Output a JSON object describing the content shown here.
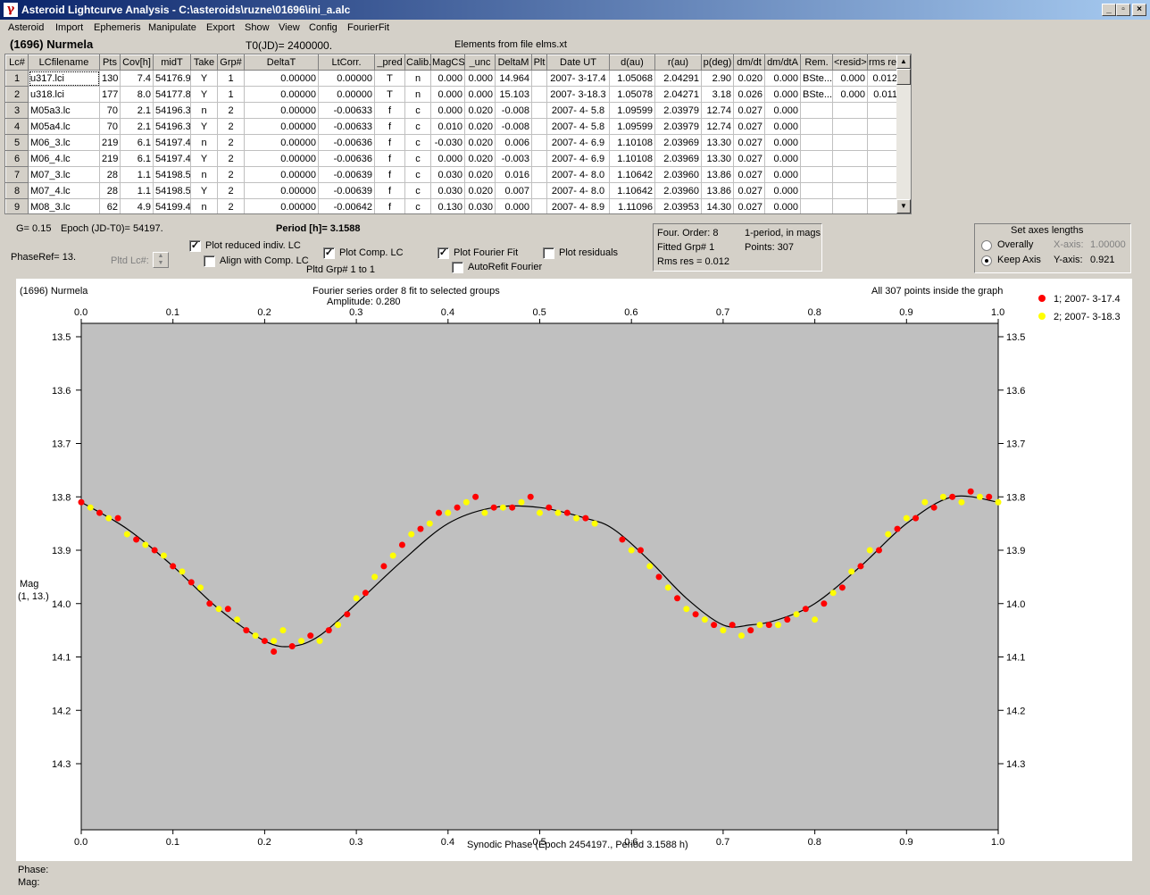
{
  "window": {
    "title": "Asteroid Lightcurve Analysis - C:\\asteroids\\ruzne\\01696\\ini_a.alc",
    "icon": "app-icon",
    "controls": [
      "_",
      "▫",
      "×"
    ]
  },
  "menu": [
    "Asteroid",
    "Import",
    "Ephemeris",
    "Manipulate",
    "Export",
    "Show",
    "View",
    "Config",
    "FourierFit"
  ],
  "info": {
    "asteroid": "(1696) Nurmela",
    "t0": "T0(JD)= 2400000.",
    "elements": "Elements from file elms.xt"
  },
  "table": {
    "headers": [
      "Lc#",
      "LCfilename",
      "Pts",
      "Cov[h]",
      "midT",
      "Take",
      "Grp#",
      "DeltaT",
      "LtCorr.",
      "_pred",
      "Calib.",
      "MagCS",
      "_unc",
      "DeltaM",
      "Plt",
      "Date UT",
      "d(au)",
      "r(au)",
      "p(deg)",
      "dm/dt",
      "dm/dtA",
      "Rem.",
      "<resid>",
      "rms res"
    ],
    "rows": [
      [
        "1",
        "u317.lci",
        "130",
        "7.4",
        "54176.9",
        "Y",
        "1",
        "0.00000",
        "0.00000",
        "T",
        "n",
        "0.000",
        "0.000",
        "14.964",
        "",
        "2007- 3-17.4",
        "1.05068",
        "2.04291",
        "2.90",
        "0.020",
        "0.000",
        "BSte...",
        "0.000",
        "0.012"
      ],
      [
        "2",
        "u318.lci",
        "177",
        "8.0",
        "54177.8",
        "Y",
        "1",
        "0.00000",
        "0.00000",
        "T",
        "n",
        "0.000",
        "0.000",
        "15.103",
        "",
        "2007- 3-18.3",
        "1.05078",
        "2.04271",
        "3.18",
        "0.026",
        "0.000",
        "BSte...",
        "0.000",
        "0.011"
      ],
      [
        "3",
        "M05a3.lc",
        "70",
        "2.1",
        "54196.3",
        "n",
        "2",
        "0.00000",
        "-0.00633",
        "f",
        "c",
        "0.000",
        "0.020",
        "-0.008",
        "",
        "2007- 4- 5.8",
        "1.09599",
        "2.03979",
        "12.74",
        "0.027",
        "0.000",
        "",
        "",
        ""
      ],
      [
        "4",
        "M05a4.lc",
        "70",
        "2.1",
        "54196.3",
        "Y",
        "2",
        "0.00000",
        "-0.00633",
        "f",
        "c",
        "0.010",
        "0.020",
        "-0.008",
        "",
        "2007- 4- 5.8",
        "1.09599",
        "2.03979",
        "12.74",
        "0.027",
        "0.000",
        "",
        "",
        ""
      ],
      [
        "5",
        "M06_3.lc",
        "219",
        "6.1",
        "54197.4",
        "n",
        "2",
        "0.00000",
        "-0.00636",
        "f",
        "c",
        "-0.030",
        "0.020",
        "0.006",
        "",
        "2007- 4- 6.9",
        "1.10108",
        "2.03969",
        "13.30",
        "0.027",
        "0.000",
        "",
        "",
        ""
      ],
      [
        "6",
        "M06_4.lc",
        "219",
        "6.1",
        "54197.4",
        "Y",
        "2",
        "0.00000",
        "-0.00636",
        "f",
        "c",
        "0.000",
        "0.020",
        "-0.003",
        "",
        "2007- 4- 6.9",
        "1.10108",
        "2.03969",
        "13.30",
        "0.027",
        "0.000",
        "",
        "",
        ""
      ],
      [
        "7",
        "M07_3.lc",
        "28",
        "1.1",
        "54198.5",
        "n",
        "2",
        "0.00000",
        "-0.00639",
        "f",
        "c",
        "0.030",
        "0.020",
        "0.016",
        "",
        "2007- 4- 8.0",
        "1.10642",
        "2.03960",
        "13.86",
        "0.027",
        "0.000",
        "",
        "",
        ""
      ],
      [
        "8",
        "M07_4.lc",
        "28",
        "1.1",
        "54198.5",
        "Y",
        "2",
        "0.00000",
        "-0.00639",
        "f",
        "c",
        "0.030",
        "0.020",
        "0.007",
        "",
        "2007- 4- 8.0",
        "1.10642",
        "2.03960",
        "13.86",
        "0.027",
        "0.000",
        "",
        "",
        ""
      ],
      [
        "9",
        "M08_3.lc",
        "62",
        "4.9",
        "54199.4",
        "n",
        "2",
        "0.00000",
        "-0.00642",
        "f",
        "c",
        "0.130",
        "0.030",
        "0.000",
        "",
        "2007- 4- 8.9",
        "1.11096",
        "2.03953",
        "14.30",
        "0.027",
        "0.000",
        "",
        "",
        ""
      ]
    ]
  },
  "controls": {
    "g_value": "G= 0.15",
    "epoch": "Epoch (JD-T0)= 54197.",
    "period": "Period [h]= 3.1588",
    "phase_ref": "PhaseRef= 13.",
    "plotted_lc_label": "Pltd Lc#:",
    "plot_reduced": "Plot reduced indiv. LC",
    "align_comp": "Align with Comp. LC",
    "plot_comp": "Plot Comp. LC",
    "plotted_grp": "Pltd Grp#  1   to   1",
    "plot_fourier": "Plot Fourier Fit",
    "autorefit": "AutoRefit Fourier",
    "plot_residuals": "Plot residuals",
    "checked": {
      "plot_reduced": true,
      "align_comp": false,
      "plot_comp": true,
      "plot_fourier": true,
      "autorefit": false,
      "plot_residuals": false
    }
  },
  "fourier_box": {
    "order": "Four. Order:  8",
    "period_note": "1-period, in mags",
    "fitted": "Fitted Grp# 1",
    "points": "Points: 307",
    "rms": "Rms res     = 0.012"
  },
  "axes_box": {
    "title": "Set axes lengths",
    "overally": "Overally",
    "keep_axis": "Keep Axis",
    "x_axis_label": "X-axis:",
    "x_axis_value": "1.00000",
    "y_axis_label": "Y-axis:",
    "y_axis_value": "0.921",
    "selected": "keep_axis"
  },
  "plot": {
    "corner_label": "(1696) Nurmela",
    "subtitle": "Fourier series order 8 fit to selected groups",
    "amplitude": "Amplitude: 0.280",
    "points_note": "All 307 points inside the graph",
    "ylabel_line1": "Mag",
    "ylabel_line2": "(1, 13.)",
    "xlabel": "Synodic Phase (Epoch 2454197., Period 3.1588 h)",
    "status_phase": "Phase:",
    "status_mag": "Mag:"
  },
  "chart_data": {
    "type": "scatter",
    "xlabel": "Synodic Phase (Epoch 2454197., Period 3.1588 h)",
    "ylabel": "Mag (1, 13.)",
    "xlim": [
      0.0,
      1.0
    ],
    "ylim": [
      14.42,
      13.49
    ],
    "y_inverted": true,
    "x_ticks": [
      "0.0",
      "0.1",
      "0.2",
      "0.3",
      "0.4",
      "0.5",
      "0.6",
      "0.7",
      "0.8",
      "0.9",
      "1.0"
    ],
    "y_ticks": [
      "13.5",
      "13.6",
      "13.7",
      "13.8",
      "13.9",
      "14.0",
      "14.1",
      "14.2",
      "14.3"
    ],
    "legend_position": "top-right",
    "fit_curve": {
      "color": "#000000",
      "x": [
        0.0,
        0.05,
        0.1,
        0.15,
        0.2,
        0.23,
        0.26,
        0.3,
        0.35,
        0.4,
        0.45,
        0.5,
        0.55,
        0.58,
        0.62,
        0.66,
        0.7,
        0.73,
        0.76,
        0.8,
        0.85,
        0.9,
        0.95,
        1.0
      ],
      "y": [
        13.81,
        13.86,
        13.93,
        14.01,
        14.07,
        14.08,
        14.06,
        14.0,
        13.92,
        13.85,
        13.82,
        13.82,
        13.84,
        13.86,
        13.92,
        13.99,
        14.04,
        14.04,
        14.03,
        14.0,
        13.93,
        13.85,
        13.8,
        13.81
      ]
    },
    "series": [
      {
        "name": "1; 2007- 3-17.4",
        "color": "#ff0000",
        "x": [
          0.0,
          0.02,
          0.04,
          0.06,
          0.08,
          0.1,
          0.12,
          0.14,
          0.16,
          0.18,
          0.2,
          0.21,
          0.23,
          0.25,
          0.27,
          0.29,
          0.31,
          0.33,
          0.35,
          0.37,
          0.39,
          0.41,
          0.43,
          0.45,
          0.47,
          0.49,
          0.51,
          0.53,
          0.55,
          0.59,
          0.61,
          0.63,
          0.65,
          0.67,
          0.69,
          0.71,
          0.73,
          0.75,
          0.77,
          0.79,
          0.81,
          0.83,
          0.85,
          0.87,
          0.89,
          0.91,
          0.93,
          0.95,
          0.97,
          0.99
        ],
        "y": [
          13.81,
          13.83,
          13.84,
          13.88,
          13.9,
          13.93,
          13.96,
          14.0,
          14.01,
          14.05,
          14.07,
          14.09,
          14.08,
          14.06,
          14.05,
          14.02,
          13.98,
          13.93,
          13.89,
          13.86,
          13.83,
          13.82,
          13.8,
          13.82,
          13.82,
          13.8,
          13.82,
          13.83,
          13.84,
          13.88,
          13.9,
          13.95,
          13.99,
          14.02,
          14.04,
          14.04,
          14.05,
          14.04,
          14.03,
          14.01,
          14.0,
          13.97,
          13.93,
          13.9,
          13.86,
          13.84,
          13.82,
          13.8,
          13.79,
          13.8
        ]
      },
      {
        "name": "2; 2007- 3-18.3",
        "color": "#ffff00",
        "x": [
          0.01,
          0.03,
          0.05,
          0.07,
          0.09,
          0.11,
          0.13,
          0.15,
          0.17,
          0.19,
          0.21,
          0.22,
          0.24,
          0.26,
          0.28,
          0.3,
          0.32,
          0.34,
          0.36,
          0.38,
          0.4,
          0.42,
          0.44,
          0.46,
          0.48,
          0.5,
          0.52,
          0.54,
          0.56,
          0.6,
          0.62,
          0.64,
          0.66,
          0.68,
          0.7,
          0.72,
          0.74,
          0.76,
          0.78,
          0.8,
          0.82,
          0.84,
          0.86,
          0.88,
          0.9,
          0.92,
          0.94,
          0.96,
          0.98,
          1.0
        ],
        "y": [
          13.82,
          13.84,
          13.87,
          13.89,
          13.91,
          13.94,
          13.97,
          14.01,
          14.03,
          14.06,
          14.07,
          14.05,
          14.07,
          14.07,
          14.04,
          13.99,
          13.95,
          13.91,
          13.87,
          13.85,
          13.83,
          13.81,
          13.83,
          13.82,
          13.81,
          13.83,
          13.83,
          13.84,
          13.85,
          13.9,
          13.93,
          13.97,
          14.01,
          14.03,
          14.05,
          14.06,
          14.04,
          14.04,
          14.02,
          14.03,
          13.98,
          13.94,
          13.9,
          13.87,
          13.84,
          13.81,
          13.8,
          13.81,
          13.8,
          13.81
        ]
      }
    ]
  }
}
